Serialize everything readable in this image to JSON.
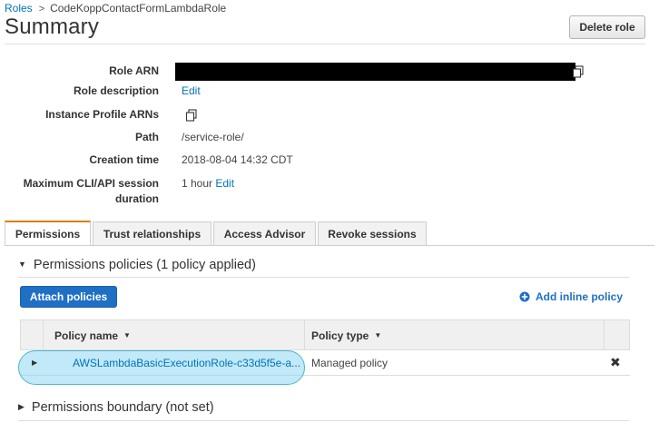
{
  "breadcrumb": {
    "root": "Roles",
    "current": "CodeKoppContactFormLambdaRole"
  },
  "page_title": "Summary",
  "delete_role_label": "Delete role",
  "summary": {
    "role_arn_label": "Role ARN",
    "role_description_label": "Role description",
    "role_description_edit": "Edit",
    "instance_profile_label": "Instance Profile ARNs",
    "path_label": "Path",
    "path_value": "/service-role/",
    "creation_time_label": "Creation time",
    "creation_time_value": "2018-08-04 14:32 CDT",
    "max_session_label_line1": "Maximum CLI/API session",
    "max_session_label_line2": "duration",
    "max_session_value": "1 hour",
    "max_session_edit": "Edit"
  },
  "tabs": [
    "Permissions",
    "Trust relationships",
    "Access Advisor",
    "Revoke sessions"
  ],
  "permissions": {
    "policies_heading": "Permissions policies (1 policy applied)",
    "attach_label": "Attach policies",
    "add_inline_label": "Add inline policy",
    "columns": {
      "policy_name": "Policy name",
      "policy_type": "Policy type"
    },
    "rows": [
      {
        "name": "AWSLambdaBasicExecutionRole-c33d5f5e-a...",
        "type": "Managed policy",
        "remove": "✖"
      }
    ],
    "boundary_heading": "Permissions boundary (not set)"
  },
  "colors": {
    "link": "#0073bb",
    "primary_button": "#1f6fc5",
    "active_tab": "#e07b00",
    "highlight": "#8ed7f1"
  },
  "icons": {
    "copy": "copy-icon",
    "plus": "plus-circle-icon",
    "remove": "close-icon"
  }
}
